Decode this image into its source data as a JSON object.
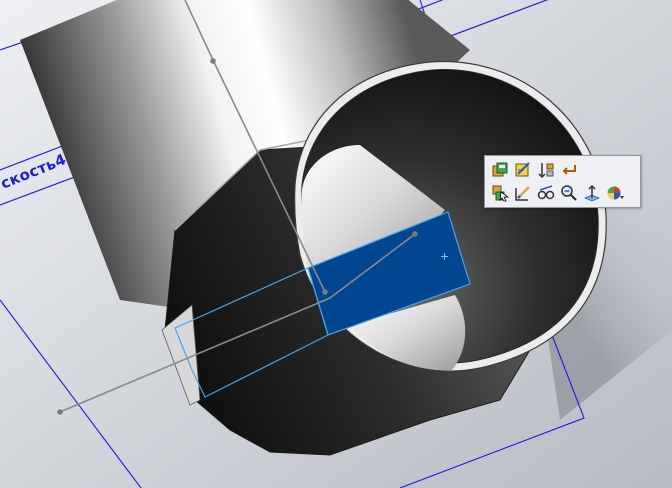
{
  "viewport": {
    "plane_label": "скость4"
  },
  "context_toolbar": {
    "row1": [
      {
        "icon": "feature-properties-icon"
      },
      {
        "icon": "edit-sketch-icon"
      },
      {
        "icon": "rollback-icon"
      },
      {
        "icon": "parent-child-icon"
      }
    ],
    "row2": [
      {
        "icon": "select-other-icon"
      },
      {
        "icon": "edit-feature-icon"
      },
      {
        "icon": "hide-show-icon"
      },
      {
        "icon": "zoom-to-selection-icon"
      },
      {
        "icon": "normal-to-icon"
      },
      {
        "icon": "appearance-icon"
      }
    ]
  },
  "colors": {
    "selection_face": "#004691",
    "plane_lines": "#1a1ae6",
    "selection_outline": "#4aa3e6",
    "background": "#c9ccd2"
  }
}
